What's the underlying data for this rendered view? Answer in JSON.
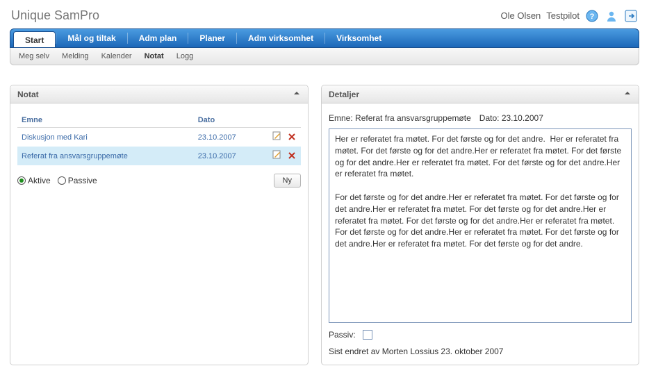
{
  "header": {
    "app_title": "Unique SamPro",
    "user_name": "Ole Olsen",
    "role": "Testpilot"
  },
  "tabs": [
    {
      "label": "Start",
      "active": true
    },
    {
      "label": "Mål og tiltak",
      "active": false
    },
    {
      "label": "Adm plan",
      "active": false
    },
    {
      "label": "Planer",
      "active": false
    },
    {
      "label": "Adm virksomhet",
      "active": false
    },
    {
      "label": "Virksomhet",
      "active": false
    }
  ],
  "subtabs": [
    {
      "label": "Meg selv",
      "strong": false
    },
    {
      "label": "Melding",
      "strong": false
    },
    {
      "label": "Kalender",
      "strong": false
    },
    {
      "label": "Notat",
      "strong": true
    },
    {
      "label": "Logg",
      "strong": false
    }
  ],
  "notat_panel": {
    "title": "Notat",
    "col_emne": "Emne",
    "col_dato": "Dato",
    "rows": [
      {
        "emne": "Diskusjon med Kari",
        "dato": "23.10.2007"
      },
      {
        "emne": "Referat fra ansvarsgruppemøte",
        "dato": "23.10.2007"
      }
    ],
    "radio_active": "Aktive",
    "radio_passive": "Passive",
    "btn_new": "Ny"
  },
  "detaljer_panel": {
    "title": "Detaljer",
    "emne_label": "Emne:",
    "emne_value": "Referat fra ansvarsgruppemøte",
    "dato_label": "Dato:",
    "dato_value": "23.10.2007",
    "text": "Her er referatet fra møtet. For det første og for det andre.  Her er referatet fra møtet. For det første og for det andre.Her er referatet fra møtet. For det første og for det andre.Her er referatet fra møtet. For det første og for det andre.Her er referatet fra møtet.\n\nFor det første og for det andre.Her er referatet fra møtet. For det første og for det andre.Her er referatet fra møtet. For det første og for det andre.Her er referatet fra møtet. For det første og for det andre.Her er referatet fra møtet. For det første og for det andre.Her er referatet fra møtet. For det første og for det andre.Her er referatet fra møtet. For det første og for det andre.",
    "passive_label": "Passiv:",
    "last_modified": "Sist endret av Morten Lossius 23. oktober 2007"
  }
}
